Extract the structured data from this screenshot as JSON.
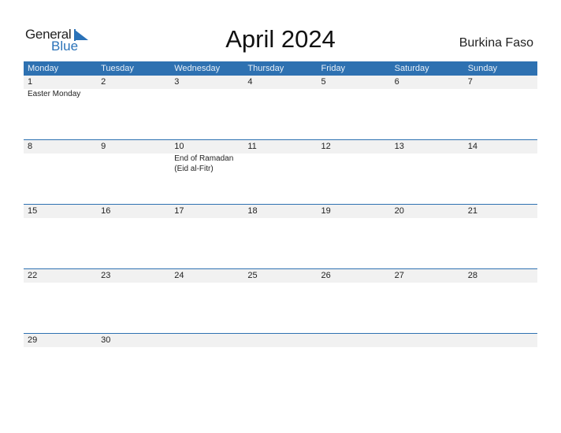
{
  "logo": {
    "general": "General",
    "blue": "Blue",
    "icon": "triangle-flag-icon",
    "accent": "#2a72b8"
  },
  "title": "April 2024",
  "country": "Burkina Faso",
  "colors": {
    "header_bg": "#2e71b1",
    "row_bar_bg": "#f1f1f1"
  },
  "weekdays": [
    "Monday",
    "Tuesday",
    "Wednesday",
    "Thursday",
    "Friday",
    "Saturday",
    "Sunday"
  ],
  "weeks": [
    {
      "days": [
        "1",
        "2",
        "3",
        "4",
        "5",
        "6",
        "7"
      ],
      "events": [
        "Easter Monday",
        "",
        "",
        "",
        "",
        "",
        ""
      ]
    },
    {
      "days": [
        "8",
        "9",
        "10",
        "11",
        "12",
        "13",
        "14"
      ],
      "events": [
        "",
        "",
        "End of Ramadan\n(Eid al-Fitr)",
        "",
        "",
        "",
        ""
      ]
    },
    {
      "days": [
        "15",
        "16",
        "17",
        "18",
        "19",
        "20",
        "21"
      ],
      "events": [
        "",
        "",
        "",
        "",
        "",
        "",
        ""
      ]
    },
    {
      "days": [
        "22",
        "23",
        "24",
        "25",
        "26",
        "27",
        "28"
      ],
      "events": [
        "",
        "",
        "",
        "",
        "",
        "",
        ""
      ]
    },
    {
      "days": [
        "29",
        "30",
        "",
        "",
        "",
        "",
        ""
      ],
      "events": [
        "",
        "",
        "",
        "",
        "",
        "",
        ""
      ]
    }
  ]
}
